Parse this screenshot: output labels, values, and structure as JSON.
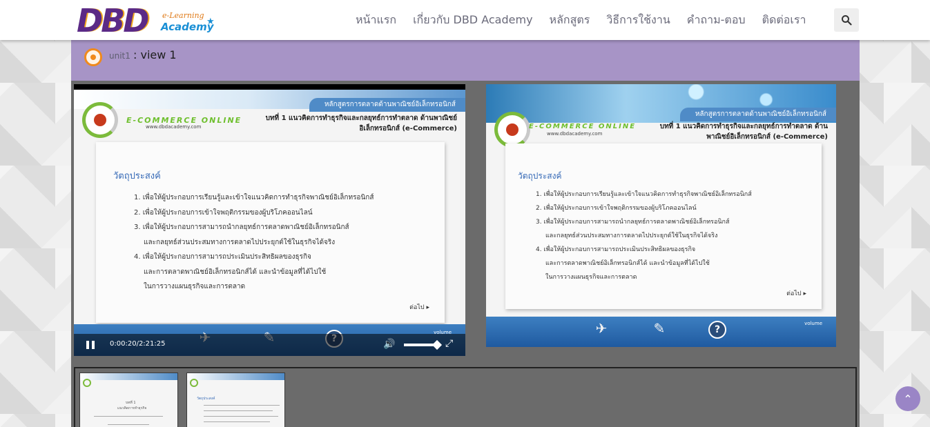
{
  "header": {
    "logo_main": "DBD",
    "logo_elearning": "e-Learning",
    "logo_academy": "Academy",
    "nav": [
      "หน้าแรก",
      "เกี่ยวกับ DBD Academy",
      "หลักสูตร",
      "วิธีการใช้งาน",
      "คำถาม-ตอบ",
      "ติดต่อเรา"
    ],
    "search_icon": "search-icon"
  },
  "unit": {
    "label": "unit1",
    "title": ": view 1"
  },
  "slide": {
    "course_tag": "หลักสูตรการตลาดด้านพาณิชย์อิเล็กทรอนิกส์",
    "brand": "E-COMMERCE ONLINE",
    "url": "www.dbdacademy.com",
    "chapter_title": "บทที่ 1 แนวคิดการทำธุรกิจและกลยุทธ์การทำตลาด ด้านพาณิชย์อิเล็กทรอนิกส์ (e-Commerce)",
    "objective_title": "วัตถุประสงค์",
    "objectives": [
      "1. เพื่อให้ผู้ประกอบการเรียนรู้และเข้าใจแนวคิดการทำธุรกิจพาณิชย์อิเล็กทรอนิกส์",
      "2. เพื่อให้ผู้ประกอบการเข้าใจพฤติกรรมของผู้บริโภคออนไลน์",
      "3. เพื่อให้ผู้ประกอบการสามารถนำกลยุทธ์การตลาดพาณิชย์อิเล็กทรอนิกส์",
      "และกลยุทธ์ส่วนประสมทางการตลาดไปประยุกต์ใช้ในธุรกิจได้จริง",
      "4. เพื่อให้ผู้ประกอบการสามารถประเมินประสิทธิผลของธุรกิจ",
      "และการตลาดพาณิชย์อิเล็กทรอนิกส์ได้ และนำข้อมูลที่ได้ไปใช้",
      "ในการวางแผนธุรกิจและการตลาด"
    ],
    "next_label": "ต่อไป ▸",
    "volume_label": "volume"
  },
  "player": {
    "current_time": "0:00:20",
    "separator": "/",
    "duration": "2:21:25",
    "volume_level": 0.85
  },
  "thumbnails": [
    {
      "caption": "บทที่ 1",
      "subtitle": "แนวคิดการทำธุรกิจ"
    },
    {
      "caption": "วัตถุประสงค์",
      "subtitle": ""
    }
  ],
  "colors": {
    "unit_bar": "#a794c6",
    "panel": "#6b6b6b",
    "accent_orange": "#f08a1c",
    "slide_blue": "#3d7fc1"
  }
}
